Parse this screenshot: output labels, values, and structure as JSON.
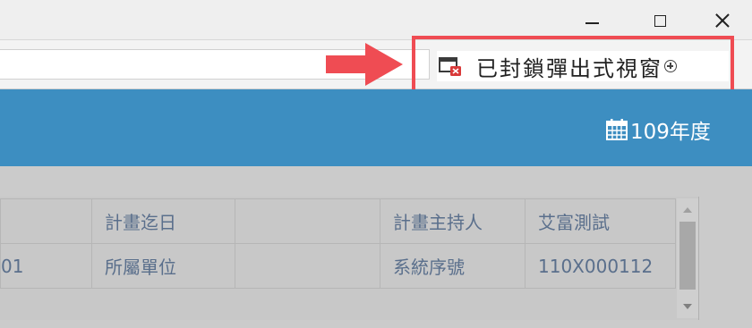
{
  "popup_blocked": {
    "label": "已封鎖彈出式視窗",
    "icon": "popup-blocked-icon"
  },
  "header": {
    "year_label": "109年度",
    "year_icon": "calendar-icon"
  },
  "table": {
    "rows": [
      [
        "",
        "計畫迄日",
        "",
        "計畫主持人",
        "艾富測試"
      ],
      [
        "01",
        "所屬單位",
        "",
        "系統序號",
        "110X000112"
      ]
    ]
  },
  "colors": {
    "header_blue": "#3d8ec1",
    "annotation_red": "#ef4c53",
    "table_text": "#5a6f8c"
  }
}
